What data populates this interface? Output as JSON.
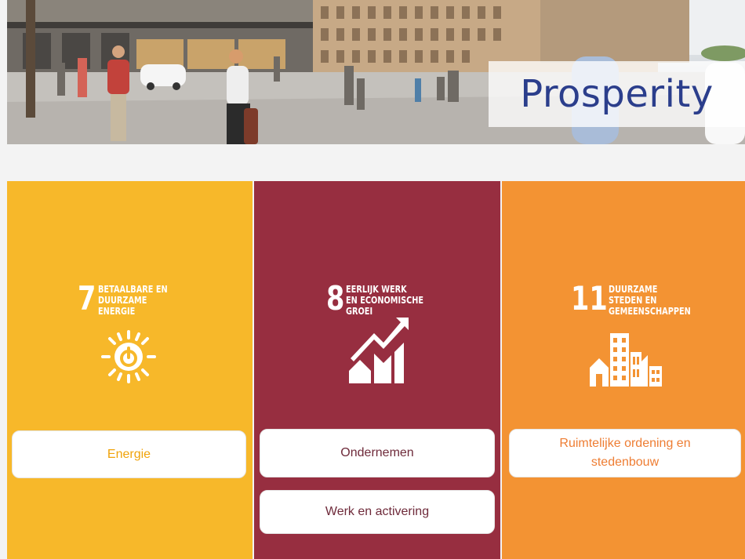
{
  "hero": {
    "title": "Prosperity"
  },
  "goals": [
    {
      "number": "7",
      "title": "BETAALBARE EN\nDUURZAME\nENERGIE",
      "icon": "sun-power-icon",
      "color": "#f7b82a",
      "buttons": [
        "Energie"
      ]
    },
    {
      "number": "8",
      "title": "EERLIJK WERK\nEN ECONOMISCHE\nGROEI",
      "icon": "growth-chart-icon",
      "color": "#972e40",
      "buttons": [
        "Ondernemen",
        "Werk en activering"
      ]
    },
    {
      "number": "11",
      "title": "DUURZAME\nSTEDEN EN\nGEMEENSCHAPPEN",
      "icon": "city-buildings-icon",
      "color": "#f39333",
      "buttons": [
        "Ruimtelijke ordening en stedenbouw"
      ]
    }
  ]
}
